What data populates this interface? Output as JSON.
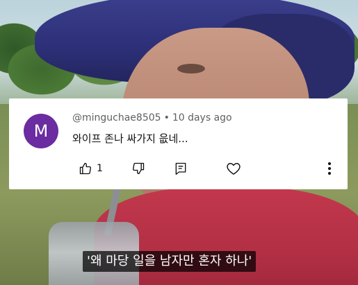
{
  "comment": {
    "avatar_letter": "M",
    "avatar_color": "#6b2ba1",
    "username": "@minguchae8505",
    "separator": "•",
    "time_ago": "10 days ago",
    "text": "와이프 존나 싸가지 읎네...",
    "like_count": "1",
    "icons": [
      "thumbs-up-icon",
      "thumbs-down-icon",
      "reply-icon",
      "heart-icon",
      "more-vert-icon"
    ]
  },
  "video": {
    "subtitle": "'왜 마당 일을 남자만 혼자 하나'"
  }
}
